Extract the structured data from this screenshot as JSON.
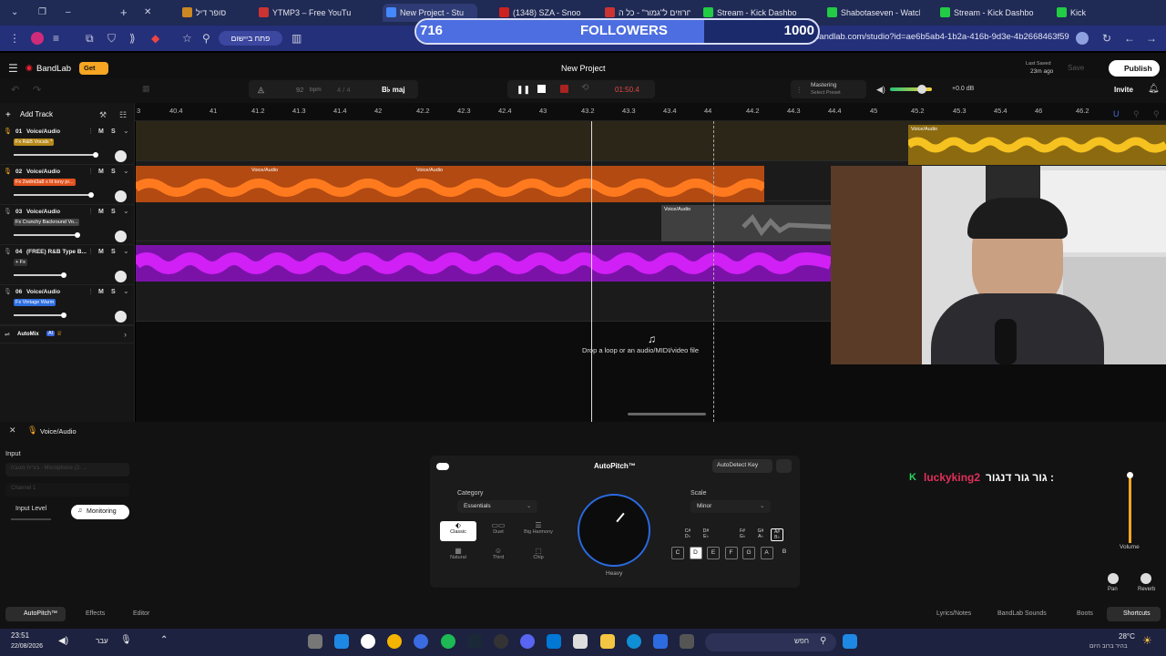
{
  "browser": {
    "tabs": [
      {
        "label": "סופר דיל"
      },
      {
        "label": "YTMP3 – Free YouTu"
      },
      {
        "label": "New Project - Stu"
      },
      {
        "label": "(1348) SZA - Snoo"
      },
      {
        "label": "חרוזים ל\"גמור\" - כל ה"
      },
      {
        "label": "Stream - Kick Dashbo"
      },
      {
        "label": "Shabotaseven - Watch"
      },
      {
        "label": "Stream - Kick Dashbo"
      },
      {
        "label": "Kick"
      }
    ],
    "url": "bandlab.com/studio?id=ae6b5ab4-1b2a-416b-9d3e-4b2668463f59",
    "app_button": "פתח ביישום",
    "new_tab": "+",
    "minimize": "–"
  },
  "followers": {
    "current": "716",
    "label": "FOLLOWERS",
    "goal": "1000",
    "progress": 0.716
  },
  "studio": {
    "brand": "BandLab",
    "get_label": "Get",
    "project_title": "New Project",
    "last_saved_label": "Last Saved",
    "last_saved_value": "23m ago",
    "save_label": "Save",
    "publish_label": "Publish",
    "invite_label": "Invite",
    "tempo_value": "92",
    "tempo_unit": "bpm",
    "time_sig": "4 / 4",
    "key_value": "B♭ maj",
    "time_readout": "01:50.4",
    "mastering_title": "Mastering",
    "mastering_sub": "Select Preset",
    "volume_db": "+0.0 dB",
    "add_track": "Add Track",
    "automix_label": "AutoMix",
    "automix_badge": "AI",
    "drop_hint": "Drop a loop or an audio/MIDI/video file"
  },
  "ruler": [
    "3",
    "40.4",
    "41",
    "41.2",
    "41.3",
    "41.4",
    "42",
    "42.2",
    "42.3",
    "42.4",
    "43",
    "43.2",
    "43.3",
    "43.4",
    "44",
    "44.2",
    "44.3",
    "44.4",
    "45",
    "45.2",
    "45.3",
    "45.4",
    "46",
    "46.2"
  ],
  "tracks": [
    {
      "num": "01",
      "name": "Voice/Audio",
      "fx": "Fx R&B Vocals *",
      "fx_color": "#b7891a",
      "mute": "M",
      "solo": "S",
      "vol": 0.9
    },
    {
      "num": "02",
      "name": "Voice/Audio",
      "fx": "Fx 2wdnt3a8 x lil tony pr...",
      "fx_color": "#e2531e",
      "mute": "M",
      "solo": "S",
      "vol": 0.85
    },
    {
      "num": "03",
      "name": "Voice/Audio",
      "fx": "Fx Crunchy Backround Vo...",
      "fx_color": "#444",
      "mute": "M",
      "solo": "S",
      "vol": 0.7
    },
    {
      "num": "04",
      "name": "(FREE) R&B Type B...",
      "fx": "+ Fx",
      "fx_color": "#333",
      "mute": "M",
      "solo": "S",
      "vol": 0.55
    },
    {
      "num": "06",
      "name": "Voice/Audio",
      "fx": "Fx Vintage Warm",
      "fx_color": "#2f6fe0",
      "mute": "M",
      "solo": "S",
      "vol": 0.55
    }
  ],
  "clips": {
    "label": "Voice/Audio"
  },
  "bottom": {
    "track_title": "Voice/Audio",
    "input_label": "Input",
    "input_device": "בורית מגובה - Microphone (2- ...",
    "channel": "Channel 1",
    "input_level": "Input Level",
    "monitoring": "Monitoring",
    "autopitch_title": "AutoPitch™",
    "autodetect": "AutoDetect Key",
    "category_label": "Category",
    "category_value": "Essentials",
    "scale_label": "Scale",
    "scale_value": "Minor",
    "knob_label": "Heavy",
    "categories": [
      "Classic",
      "Duet",
      "Big Harmony",
      "Natural",
      "Third",
      "Chip"
    ],
    "sharps": [
      "C#\nD♭",
      "D#\nE♭",
      "F#\nG♭",
      "G#\nA♭",
      "A#\nB♭"
    ],
    "keys": [
      "C",
      "D",
      "E",
      "F",
      "G",
      "A",
      "B"
    ],
    "chat_user": "luckyking2",
    "chat_msg": "גור גור דנגור :",
    "volume_label": "Volume",
    "pan_label": "Pan",
    "reverb_label": "Reverb",
    "tabs": [
      "AutoPitch™",
      "Effects",
      "Editor"
    ],
    "right_tabs": [
      "Lyrics/Notes",
      "BandLab Sounds",
      "Boots",
      "Shortcuts"
    ]
  },
  "taskbar": {
    "time": "23:51",
    "date": "22/08/2026",
    "lang": "עבר",
    "search": "חפש",
    "temp": "28°C",
    "weather": "בהיר ברוב היום"
  }
}
